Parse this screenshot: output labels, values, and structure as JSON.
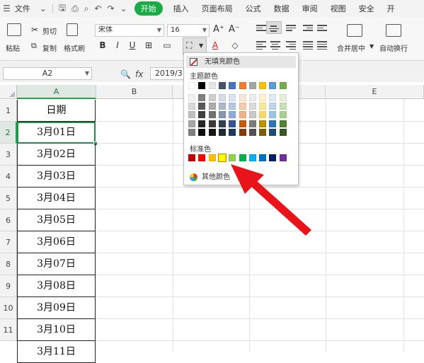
{
  "menubar": {
    "file": "文件",
    "tabs": [
      "开始",
      "插入",
      "页面布局",
      "公式",
      "数据",
      "审阅",
      "视图",
      "安全",
      "开"
    ]
  },
  "toolbar": {
    "paste": "粘贴",
    "cut": "剪切",
    "copy": "复制",
    "format_painter": "格式刷",
    "font_name": "宋体",
    "font_size": "16",
    "bold": "B",
    "italic": "I",
    "underline": "U",
    "merge_center": "合并居中",
    "wrap_text": "自动换行"
  },
  "formula_bar": {
    "name_box": "A2",
    "fx": "fx",
    "value": "2019/3"
  },
  "grid": {
    "columns": [
      "A",
      "B",
      "C",
      "D",
      "E"
    ],
    "rows": [
      "1",
      "2",
      "3",
      "4",
      "5",
      "6",
      "7",
      "8",
      "9",
      "10",
      "11"
    ],
    "cells": [
      "日期",
      "3月01日",
      "3月02日",
      "3月03日",
      "3月04日",
      "3月05日",
      "3月06日",
      "3月07日",
      "3月08日",
      "3月09日",
      "3月10日",
      "3月11日"
    ]
  },
  "color_popup": {
    "no_fill": "无填充颜色",
    "theme_colors": "主题颜色",
    "standard_colors": "标准色",
    "more_colors": "其他颜色",
    "theme_top": [
      "#ffffff",
      "#000000",
      "#e7e6e6",
      "#44546a",
      "#4472c4",
      "#ed7d31",
      "#a5a5a5",
      "#ffc000",
      "#5b9bd5",
      "#70ad47"
    ],
    "theme_shades": [
      [
        "#f2f2f2",
        "#7f7f7f",
        "#d0cece",
        "#d6dce4",
        "#d9e2f3",
        "#fbe5d6",
        "#ededed",
        "#fff2cc",
        "#deebf7",
        "#e2efda"
      ],
      [
        "#d9d9d9",
        "#595959",
        "#aeabab",
        "#adb9ca",
        "#b4c7e7",
        "#f8cbad",
        "#dbdbdb",
        "#ffe699",
        "#bdd7ee",
        "#c5e0b4"
      ],
      [
        "#bfbfbf",
        "#404040",
        "#757171",
        "#8497b0",
        "#8faadc",
        "#f4b183",
        "#c9c9c9",
        "#ffd966",
        "#9dc3e6",
        "#a9d18e"
      ],
      [
        "#a6a6a6",
        "#262626",
        "#3b3838",
        "#323f4f",
        "#2f5597",
        "#c55a11",
        "#7b7b7b",
        "#bf9000",
        "#2e75b6",
        "#548235"
      ],
      [
        "#808080",
        "#0d0d0d",
        "#171515",
        "#222a35",
        "#1f3864",
        "#843c0c",
        "#525252",
        "#7f6000",
        "#1f4e79",
        "#385723"
      ]
    ],
    "standard": [
      "#c00000",
      "#ff0000",
      "#ffc000",
      "#ffff00",
      "#92d050",
      "#00b050",
      "#00b0f0",
      "#0070c0",
      "#002060",
      "#7030a0"
    ],
    "highlighted_index": 3
  },
  "annotation": {
    "arrow_color": "#e8141a"
  }
}
